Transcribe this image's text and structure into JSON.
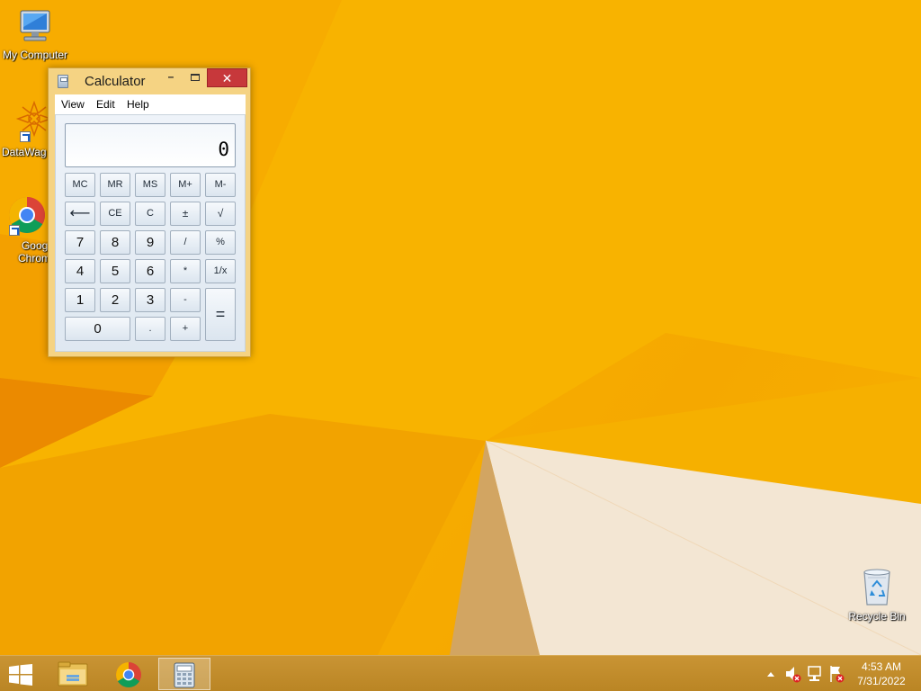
{
  "desktop": {
    "icons": [
      {
        "label": "My Computer",
        "icon": "computer-icon"
      },
      {
        "label": "DataWag",
        "icon": "datawag-icon"
      },
      {
        "label": "Googl\nChrom",
        "line1": "Googl",
        "line2": "Chrom",
        "icon": "chrome-icon"
      },
      {
        "label": "Recycle Bin",
        "icon": "recycle-bin-icon"
      }
    ]
  },
  "calculator": {
    "title": "Calculator",
    "close_glyph": "✕",
    "minimize_glyph": "–",
    "menu": [
      "View",
      "Edit",
      "Help"
    ],
    "display": "0",
    "keys": {
      "mc": "MC",
      "mr": "MR",
      "ms": "MS",
      "mplus": "M+",
      "mminus": "M-",
      "back": "⟵",
      "ce": "CE",
      "c": "C",
      "sign": "±",
      "sqrt": "√",
      "k7": "7",
      "k8": "8",
      "k9": "9",
      "div": "/",
      "pct": "%",
      "k4": "4",
      "k5": "5",
      "k6": "6",
      "mul": "*",
      "recip": "1/x",
      "k1": "1",
      "k2": "2",
      "k3": "3",
      "sub": "-",
      "eq": "=",
      "k0": "0",
      "dot": ".",
      "add": "+"
    }
  },
  "taskbar": {
    "pinned": [
      "file-explorer-icon",
      "chrome-icon",
      "calculator-icon"
    ],
    "active": "calculator-icon",
    "tray_icons": [
      "show-hidden-icons-icon",
      "volume-muted-icon",
      "network-icon",
      "action-center-icon"
    ],
    "clock": {
      "time": "4:53 AM",
      "date": "7/31/2022"
    }
  },
  "colors": {
    "accent": "#f8b000",
    "close_button": "#c7383b",
    "taskbar": "#c18c2c"
  }
}
